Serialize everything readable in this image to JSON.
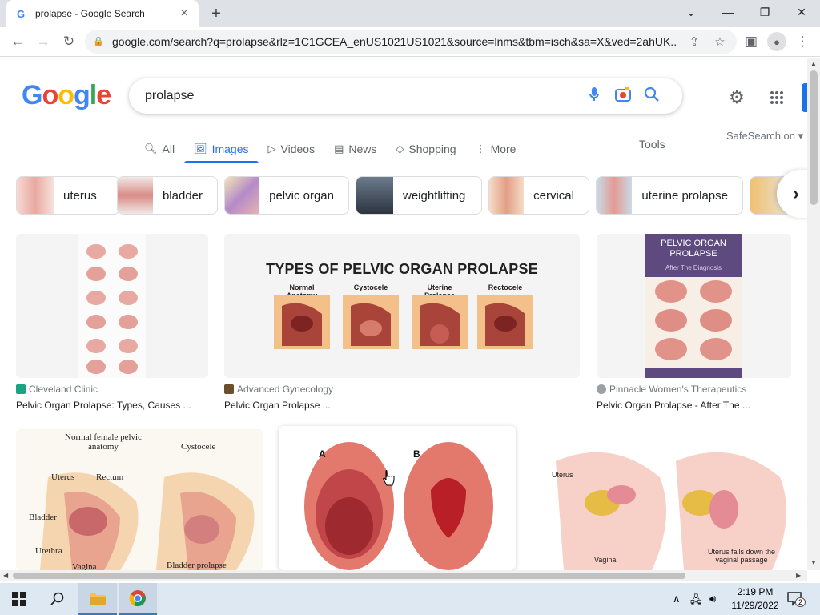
{
  "browser": {
    "tab_title": "prolapse - Google Search",
    "url": "google.com/search?q=prolapse&rlz=1C1GCEA_enUS1021US1021&source=lnms&tbm=isch&sa=X&ved=2ahUK..."
  },
  "search": {
    "query": "prolapse",
    "tabs": [
      "All",
      "Images",
      "Videos",
      "News",
      "Shopping",
      "More"
    ],
    "active_tab": "Images",
    "tools_label": "Tools",
    "safesearch_label": "SafeSearch on"
  },
  "chips": [
    "uterus",
    "bladder",
    "pelvic organ",
    "weightlifting",
    "cervical",
    "uterine prolapse"
  ],
  "results": [
    {
      "source": "Cleveland Clinic",
      "title": "Pelvic Organ Prolapse: Types, Causes ..."
    },
    {
      "source": "Advanced Gynecology",
      "title": "Pelvic Organ Prolapse ..."
    },
    {
      "source": "Pinnacle Women's Therapeutics",
      "title": "Pelvic Organ Prolapse - After The ..."
    }
  ],
  "image_text": {
    "r1c2_heading": "TYPES OF PELVIC ORGAN PROLAPSE",
    "r1c2_labels": [
      "Normal Anatomy",
      "Cystocele",
      "Uterine Prolapse",
      "Rectocele"
    ],
    "r1c3_heading": "PELVIC ORGAN PROLAPSE",
    "r1c3_sub": "After The Diagnosis",
    "r2c1_labels": [
      "Normal female pelvic anatomy",
      "Cystocele",
      "Uterus",
      "Rectum",
      "Bladder",
      "Urethra",
      "Vagina",
      "Bladder prolapse"
    ],
    "r2c2_labels": [
      "A",
      "B"
    ],
    "r2c3_labels": [
      "Uterus",
      "Vagina",
      "Uterus falls down the vaginal passage"
    ]
  },
  "taskbar": {
    "time": "2:19 PM",
    "date": "11/29/2022",
    "notification_count": "2"
  }
}
